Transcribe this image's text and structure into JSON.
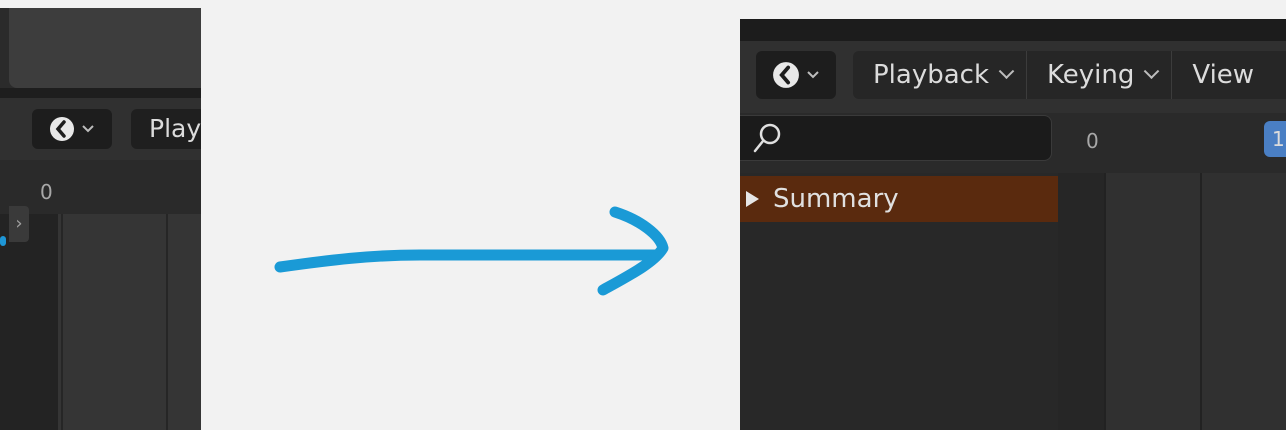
{
  "left_panel": {
    "header": {
      "menu_label": "Play"
    },
    "ruler": {
      "frame_start": "0"
    },
    "sidebar_toggle_icon": "chevron-right-icon"
  },
  "right_panel": {
    "header": {
      "editor_type_icon": "clock-icon",
      "menus": [
        {
          "label": "Playback"
        },
        {
          "label": "Keying"
        },
        {
          "label": "View"
        }
      ]
    },
    "search": {
      "value": "",
      "icon": "search-icon"
    },
    "ruler": {
      "frame_start": "0",
      "current_frame": "1"
    },
    "channels": [
      {
        "label": "Summary",
        "expanded": false
      }
    ]
  },
  "annotation": {
    "type": "arrow",
    "color": "#1a9ad6"
  },
  "colors": {
    "background": "#f2f2f2",
    "summary_row": "#5a2a0e",
    "current_frame": "#4a7fc4",
    "arrow": "#1a9ad6"
  }
}
